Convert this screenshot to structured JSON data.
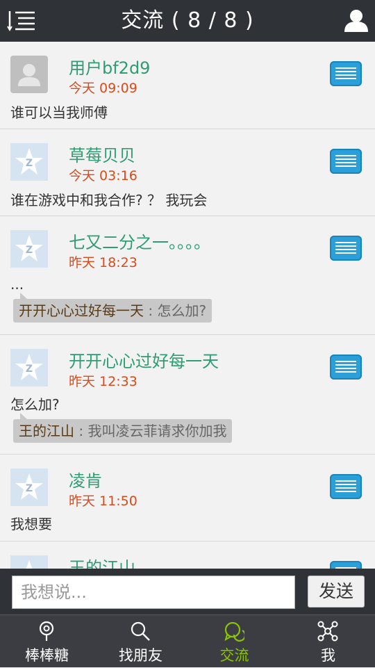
{
  "header": {
    "title": "交流 ( 8 / 8 )"
  },
  "posts": [
    {
      "name": "用户bf2d9",
      "time": "今天 09:09",
      "message": "谁可以当我师傅",
      "avatar": "default-user-avatar"
    },
    {
      "name": "草莓贝贝",
      "time": "今天 03:16",
      "message": "谁在游戏中和我合作? ？ 我玩会",
      "avatar": "qzone-star-avatar"
    },
    {
      "name": "七又二分之一。。。。",
      "time": "昨天 18:23",
      "message": "...",
      "avatar": "qzone-star-avatar",
      "reply": {
        "name": "开开心心过好每一天",
        "separator": " : ",
        "text": "怎么加?"
      }
    },
    {
      "name": "开开心心过好每一天",
      "time": "昨天 12:33",
      "message": "怎么加?",
      "avatar": "qzone-star-avatar",
      "reply": {
        "name": "王的江山",
        "separator": " : ",
        "text": "我叫凌云菲请求你加我"
      }
    },
    {
      "name": "凌肯",
      "time": "昨天 11:50",
      "message": "我想要",
      "avatar": "qzone-star-avatar"
    },
    {
      "name": "王的江山",
      "time": "",
      "message": "",
      "avatar": "qzone-star-avatar"
    }
  ],
  "input": {
    "placeholder": "我想说...",
    "send_label": "发送"
  },
  "tabs": [
    {
      "label": "棒棒糖",
      "icon": "location-pin-icon"
    },
    {
      "label": "找朋友",
      "icon": "search-icon"
    },
    {
      "label": "交流",
      "icon": "chat-bubbles-icon",
      "active": true
    },
    {
      "label": "我",
      "icon": "network-nodes-icon"
    }
  ],
  "colors": {
    "accent": "#8bc500",
    "name": "#2f9c74",
    "time": "#d84b1b",
    "menu_button": "#2a9fd8",
    "bar": "#2f3237"
  }
}
